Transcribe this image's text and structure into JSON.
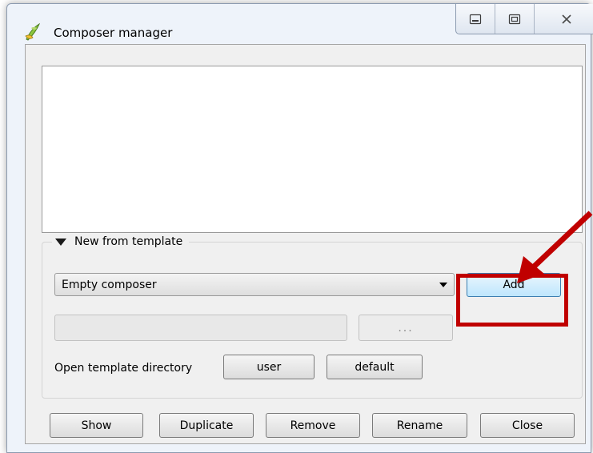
{
  "window": {
    "title": "Composer manager"
  },
  "group": {
    "title": "New from template",
    "template_select": {
      "value": "Empty composer"
    },
    "add_label": "Add",
    "browse_label": "...",
    "open_dir_label": "Open template directory",
    "user_label": "user",
    "default_label": "default"
  },
  "buttons": {
    "show": "Show",
    "duplicate": "Duplicate",
    "remove": "Remove",
    "rename": "Rename",
    "close": "Close"
  },
  "colors": {
    "annotation": "#c00000",
    "window_frame": "#eef3fa",
    "dialog_bg": "#f0f0f0",
    "default_button": "#bee6fd"
  },
  "icons": {
    "app": "qgis-icon",
    "minimize": "minimize-icon",
    "maximize": "maximize-icon",
    "close": "close-icon",
    "collapse": "triangle-down-icon",
    "dropdown": "chevron-down-icon"
  }
}
